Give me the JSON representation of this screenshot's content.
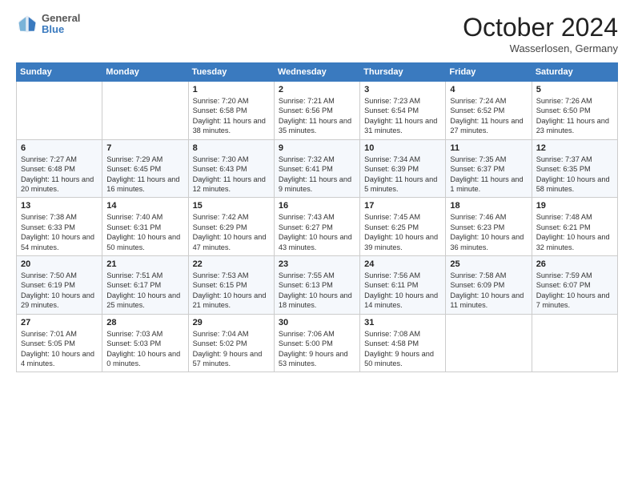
{
  "header": {
    "logo_general": "General",
    "logo_blue": "Blue",
    "month_year": "October 2024",
    "location": "Wasserlosen, Germany"
  },
  "weekdays": [
    "Sunday",
    "Monday",
    "Tuesday",
    "Wednesday",
    "Thursday",
    "Friday",
    "Saturday"
  ],
  "weeks": [
    {
      "days": [
        {
          "num": "",
          "info": ""
        },
        {
          "num": "",
          "info": ""
        },
        {
          "num": "1",
          "info": "Sunrise: 7:20 AM\nSunset: 6:58 PM\nDaylight: 11 hours and 38 minutes."
        },
        {
          "num": "2",
          "info": "Sunrise: 7:21 AM\nSunset: 6:56 PM\nDaylight: 11 hours and 35 minutes."
        },
        {
          "num": "3",
          "info": "Sunrise: 7:23 AM\nSunset: 6:54 PM\nDaylight: 11 hours and 31 minutes."
        },
        {
          "num": "4",
          "info": "Sunrise: 7:24 AM\nSunset: 6:52 PM\nDaylight: 11 hours and 27 minutes."
        },
        {
          "num": "5",
          "info": "Sunrise: 7:26 AM\nSunset: 6:50 PM\nDaylight: 11 hours and 23 minutes."
        }
      ]
    },
    {
      "days": [
        {
          "num": "6",
          "info": "Sunrise: 7:27 AM\nSunset: 6:48 PM\nDaylight: 11 hours and 20 minutes."
        },
        {
          "num": "7",
          "info": "Sunrise: 7:29 AM\nSunset: 6:45 PM\nDaylight: 11 hours and 16 minutes."
        },
        {
          "num": "8",
          "info": "Sunrise: 7:30 AM\nSunset: 6:43 PM\nDaylight: 11 hours and 12 minutes."
        },
        {
          "num": "9",
          "info": "Sunrise: 7:32 AM\nSunset: 6:41 PM\nDaylight: 11 hours and 9 minutes."
        },
        {
          "num": "10",
          "info": "Sunrise: 7:34 AM\nSunset: 6:39 PM\nDaylight: 11 hours and 5 minutes."
        },
        {
          "num": "11",
          "info": "Sunrise: 7:35 AM\nSunset: 6:37 PM\nDaylight: 11 hours and 1 minute."
        },
        {
          "num": "12",
          "info": "Sunrise: 7:37 AM\nSunset: 6:35 PM\nDaylight: 10 hours and 58 minutes."
        }
      ]
    },
    {
      "days": [
        {
          "num": "13",
          "info": "Sunrise: 7:38 AM\nSunset: 6:33 PM\nDaylight: 10 hours and 54 minutes."
        },
        {
          "num": "14",
          "info": "Sunrise: 7:40 AM\nSunset: 6:31 PM\nDaylight: 10 hours and 50 minutes."
        },
        {
          "num": "15",
          "info": "Sunrise: 7:42 AM\nSunset: 6:29 PM\nDaylight: 10 hours and 47 minutes."
        },
        {
          "num": "16",
          "info": "Sunrise: 7:43 AM\nSunset: 6:27 PM\nDaylight: 10 hours and 43 minutes."
        },
        {
          "num": "17",
          "info": "Sunrise: 7:45 AM\nSunset: 6:25 PM\nDaylight: 10 hours and 39 minutes."
        },
        {
          "num": "18",
          "info": "Sunrise: 7:46 AM\nSunset: 6:23 PM\nDaylight: 10 hours and 36 minutes."
        },
        {
          "num": "19",
          "info": "Sunrise: 7:48 AM\nSunset: 6:21 PM\nDaylight: 10 hours and 32 minutes."
        }
      ]
    },
    {
      "days": [
        {
          "num": "20",
          "info": "Sunrise: 7:50 AM\nSunset: 6:19 PM\nDaylight: 10 hours and 29 minutes."
        },
        {
          "num": "21",
          "info": "Sunrise: 7:51 AM\nSunset: 6:17 PM\nDaylight: 10 hours and 25 minutes."
        },
        {
          "num": "22",
          "info": "Sunrise: 7:53 AM\nSunset: 6:15 PM\nDaylight: 10 hours and 21 minutes."
        },
        {
          "num": "23",
          "info": "Sunrise: 7:55 AM\nSunset: 6:13 PM\nDaylight: 10 hours and 18 minutes."
        },
        {
          "num": "24",
          "info": "Sunrise: 7:56 AM\nSunset: 6:11 PM\nDaylight: 10 hours and 14 minutes."
        },
        {
          "num": "25",
          "info": "Sunrise: 7:58 AM\nSunset: 6:09 PM\nDaylight: 10 hours and 11 minutes."
        },
        {
          "num": "26",
          "info": "Sunrise: 7:59 AM\nSunset: 6:07 PM\nDaylight: 10 hours and 7 minutes."
        }
      ]
    },
    {
      "days": [
        {
          "num": "27",
          "info": "Sunrise: 7:01 AM\nSunset: 5:05 PM\nDaylight: 10 hours and 4 minutes."
        },
        {
          "num": "28",
          "info": "Sunrise: 7:03 AM\nSunset: 5:03 PM\nDaylight: 10 hours and 0 minutes."
        },
        {
          "num": "29",
          "info": "Sunrise: 7:04 AM\nSunset: 5:02 PM\nDaylight: 9 hours and 57 minutes."
        },
        {
          "num": "30",
          "info": "Sunrise: 7:06 AM\nSunset: 5:00 PM\nDaylight: 9 hours and 53 minutes."
        },
        {
          "num": "31",
          "info": "Sunrise: 7:08 AM\nSunset: 4:58 PM\nDaylight: 9 hours and 50 minutes."
        },
        {
          "num": "",
          "info": ""
        },
        {
          "num": "",
          "info": ""
        }
      ]
    }
  ]
}
